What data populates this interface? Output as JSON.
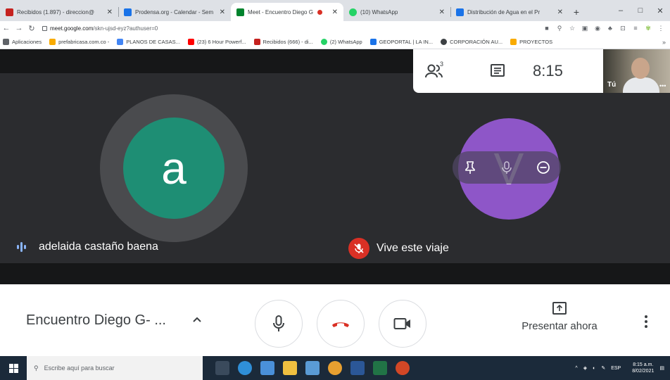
{
  "browser": {
    "tabs": [
      {
        "title": "Recibidos (1.897) - direccion@",
        "favicon_color": "#c5221f",
        "active": false
      },
      {
        "title": "Prodensa.org - Calendar - Sem",
        "favicon_color": "#1a73e8",
        "active": false
      },
      {
        "title": "Meet - Encuentro Diego G",
        "favicon_color": "#00832d",
        "active": true,
        "recording": true
      },
      {
        "title": "(10) WhatsApp",
        "favicon_color": "#25d366",
        "active": false
      },
      {
        "title": "Distribución de Agua en el Pr",
        "favicon_color": "#1a73e8",
        "active": false
      }
    ],
    "new_tab": "+",
    "window_controls": [
      "–",
      "□",
      "✕"
    ],
    "url": {
      "host": "meet.google.com",
      "path": "/skn-ujsd-eyz?authuser=0"
    },
    "bookmarks": [
      {
        "label": "Aplicaciones",
        "color": "#5f6368"
      },
      {
        "label": "prefabricasa.com.co -",
        "color": "#f9ab00"
      },
      {
        "label": "PLANOS DE CASAS...",
        "color": "#4285f4"
      },
      {
        "label": "(23) 6 Hour Powerf...",
        "color": "#ff0000"
      },
      {
        "label": "Recibidos (666) - di...",
        "color": "#c5221f"
      },
      {
        "label": "(2) WhatsApp",
        "color": "#25d366"
      },
      {
        "label": "GEOPORTAL | LA IN...",
        "color": "#1a73e8"
      },
      {
        "label": "CORPORACIÓN AU...",
        "color": "#3c4043"
      },
      {
        "label": "PROYECTOS",
        "color": "#f9ab00"
      }
    ]
  },
  "meet": {
    "participants_count": "3",
    "clock": "8:15",
    "self_label": "Tú",
    "participant_left": {
      "initial": "a",
      "name": "adelaida castaño baena"
    },
    "participant_right": {
      "initial": "V",
      "name": "Vive este viaje"
    },
    "meeting_title": "Encuentro Diego G- ...",
    "present_label": "Presentar ahora",
    "colors": {
      "left_avatar": "#1e8e74",
      "right_avatar": "#8e56c8",
      "hangup": "#d93025"
    }
  },
  "taskbar": {
    "search_placeholder": "Escribe aquí para buscar",
    "tray_lang": "ESP",
    "time": "8:15 a.m.",
    "date": "8/02/2021"
  }
}
